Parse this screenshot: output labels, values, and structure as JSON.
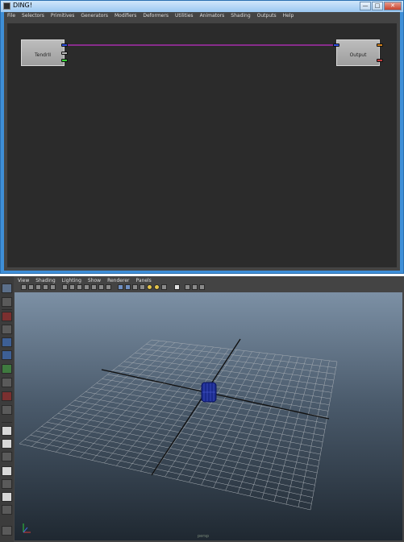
{
  "window": {
    "title": "DING!",
    "buttons": {
      "minimize": "—",
      "maximize": "□",
      "close": "✕"
    }
  },
  "menubar": {
    "items": [
      "File",
      "Selectors",
      "Primitives",
      "Generators",
      "Modifiers",
      "Deformers",
      "Utilities",
      "Animators",
      "Shading",
      "Outputs",
      "Help"
    ]
  },
  "graph": {
    "nodes": [
      {
        "label": "TendrII"
      },
      {
        "label": "Output"
      }
    ],
    "link_color": "#c02fc7",
    "port_colors": {
      "blue": "#2f4fe0",
      "gray": "#b8b8b8",
      "green": "#39d339",
      "orange": "#d4821c",
      "red": "#c23a3a"
    }
  },
  "maya": {
    "panel_menu": [
      "View",
      "Shading",
      "Lighting",
      "Show",
      "Renderer",
      "Panels"
    ],
    "viewport_label": "persp",
    "colors": {
      "grid": "#a8aeb4",
      "axis": "#111111",
      "object": "#1a2a8c"
    }
  }
}
